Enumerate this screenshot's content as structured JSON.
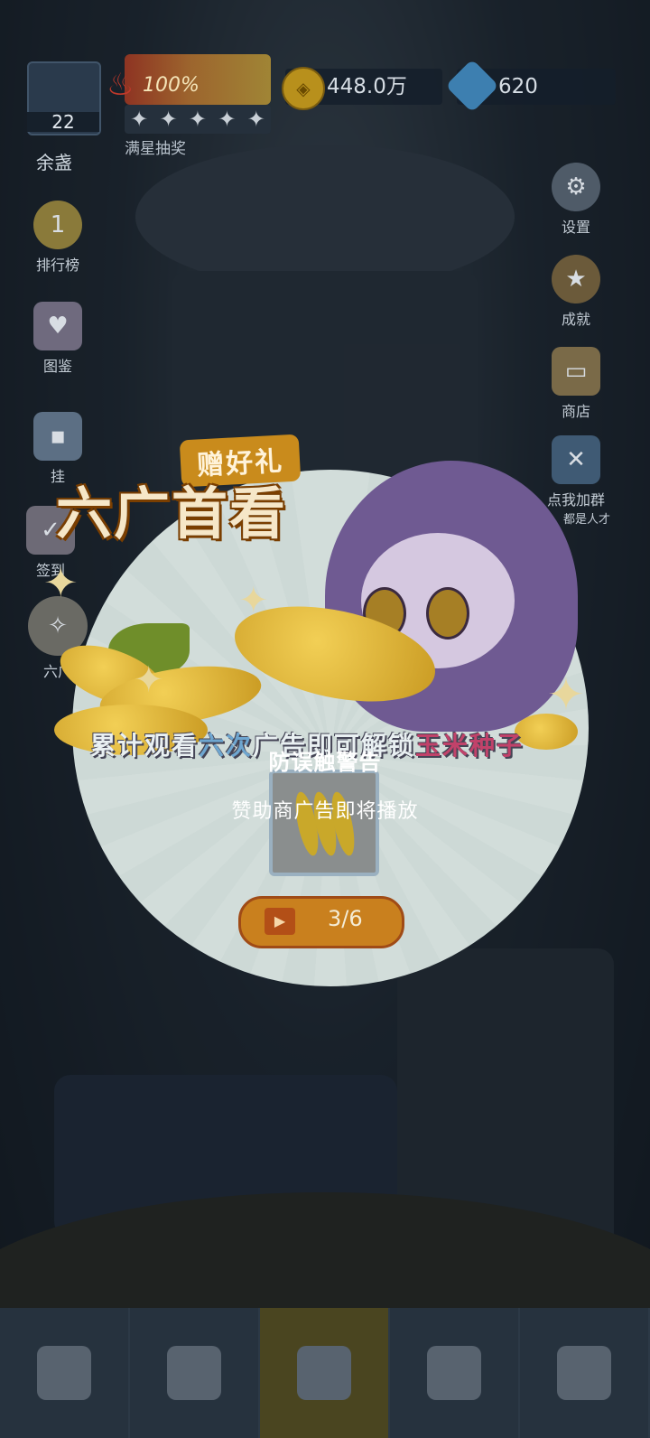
{
  "player": {
    "level": "22",
    "name": "余盏"
  },
  "star_reward": {
    "progress": "100%",
    "stars_filled": 5,
    "stars_total": 5,
    "label": "满星抽奖"
  },
  "resources": {
    "coins": "448.0万",
    "gems": "620"
  },
  "left_menu": [
    {
      "label": "排行榜",
      "icon": "medal-icon"
    },
    {
      "label": "图鉴",
      "icon": "book-icon"
    },
    {
      "label": "挂",
      "icon": "robot-icon"
    },
    {
      "label": "签到",
      "icon": "calendar-icon"
    },
    {
      "label": "六广",
      "icon": "corn-icon"
    }
  ],
  "right_menu": [
    {
      "label": "设置",
      "icon": "gear-icon"
    },
    {
      "label": "成就",
      "icon": "badge-icon"
    },
    {
      "label": "商店",
      "icon": "basket-icon"
    },
    {
      "label": "点我加群",
      "icon": "group-icon"
    },
    {
      "label": "都是人才",
      "icon": ""
    }
  ],
  "popup": {
    "gift_label": "赠好礼",
    "title": "六广首看",
    "desc_pre": "累计观看",
    "desc_hl1": "六次",
    "desc_mid": "广告即可解锁",
    "desc_hl2": "玉米种子",
    "progress": "3/6"
  },
  "warning": {
    "title": "防误触警告",
    "subtitle": "赞助商广告即将播放"
  },
  "colors": {
    "coin": "#b8901c",
    "gem": "#3d7fb0",
    "popup_bg": "#cdd9d6",
    "highlight_blue": "#6ea6d0",
    "highlight_red": "#c1426a"
  }
}
